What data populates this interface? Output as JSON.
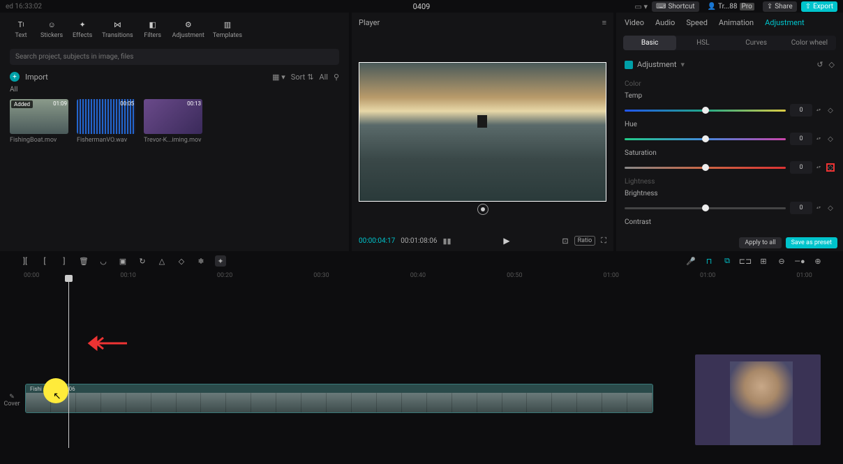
{
  "top": {
    "left": "ed 16:33:02",
    "title": "0409",
    "shortcut": "Shortcut",
    "user": "Tr...88",
    "badge": "Pro",
    "share": "Share",
    "export": "Export"
  },
  "tools": [
    {
      "label": "Text"
    },
    {
      "label": "Stickers"
    },
    {
      "label": "Effects"
    },
    {
      "label": "Transitions"
    },
    {
      "label": "Filters"
    },
    {
      "label": "Adjustment"
    },
    {
      "label": "Templates"
    }
  ],
  "search": {
    "placeholder": "Search project, subjects in image, files"
  },
  "import": {
    "label": "Import",
    "sort": "Sort",
    "all": "All"
  },
  "allTab": "All",
  "media": [
    {
      "name": "FishingBoat.mov",
      "dur": "01:09",
      "badge": "Added"
    },
    {
      "name": "FishermanVO.wav",
      "dur": "00:05",
      "badge": ""
    },
    {
      "name": "Trevor-K...iming.mov",
      "dur": "00:13",
      "badge": ""
    }
  ],
  "player": {
    "title": "Player",
    "cur": "00:00:04:17",
    "total": "00:01:08:06",
    "ratio": "Ratio"
  },
  "rp": {
    "tabs": [
      "Video",
      "Audio",
      "Speed",
      "Animation",
      "Adjustment"
    ],
    "activeTab": 4,
    "subtabs": [
      "Basic",
      "HSL",
      "Curves",
      "Color wheel"
    ],
    "activeSub": 0,
    "headerLabel": "Adjustment",
    "colorLabel": "Color",
    "lightnessLabel": "Lightness",
    "params": [
      {
        "name": "Temp",
        "value": "0",
        "slider": "temp"
      },
      {
        "name": "Hue",
        "value": "0",
        "slider": "hue"
      },
      {
        "name": "Saturation",
        "value": "0",
        "slider": "sat"
      }
    ],
    "light": [
      {
        "name": "Brightness",
        "value": "0"
      },
      {
        "name": "Contrast",
        "value": ""
      }
    ],
    "applyAll": "Apply to all",
    "savePreset": "Save as preset"
  },
  "cover": "Cover",
  "ruler": [
    "00:00",
    "00:10",
    "00:20",
    "00:30",
    "00:40",
    "00:50",
    "01:00",
    "01:00",
    "01:00"
  ],
  "clip": {
    "name": "Fishi",
    "dur": "00:01:08:06"
  }
}
